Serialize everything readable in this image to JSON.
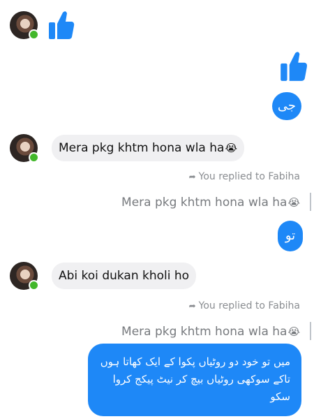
{
  "colors": {
    "outgoing": "#1e88f7",
    "incoming": "#f0f0f2",
    "online": "#42b72a",
    "meta": "#8a8d91"
  },
  "messages": [
    {
      "type": "incoming-like",
      "icon": "thumbs-up-icon"
    },
    {
      "type": "outgoing-like",
      "icon": "thumbs-up-icon"
    },
    {
      "type": "outgoing",
      "text": "جی"
    },
    {
      "type": "incoming",
      "text": "Mera pkg khtm hona wla ha",
      "emoji": "😭"
    },
    {
      "type": "reply",
      "meta": "You replied to Fabiha",
      "quoted": "Mera pkg khtm hona wla ha",
      "quoted_emoji": "😭",
      "text": "تو"
    },
    {
      "type": "incoming",
      "text": "Abi koi dukan kholi ho"
    },
    {
      "type": "reply",
      "meta": "You replied to Fabiha",
      "quoted": "Mera pkg khtm hona wla ha",
      "quoted_emoji": "😭",
      "text": "میں تو خود دو روٹیاں پکوا کے ایک کھاتا ہوں تاکے سوکھی روٹیاں بیچ کر نیٹ پیکج کروا سکو"
    }
  ]
}
